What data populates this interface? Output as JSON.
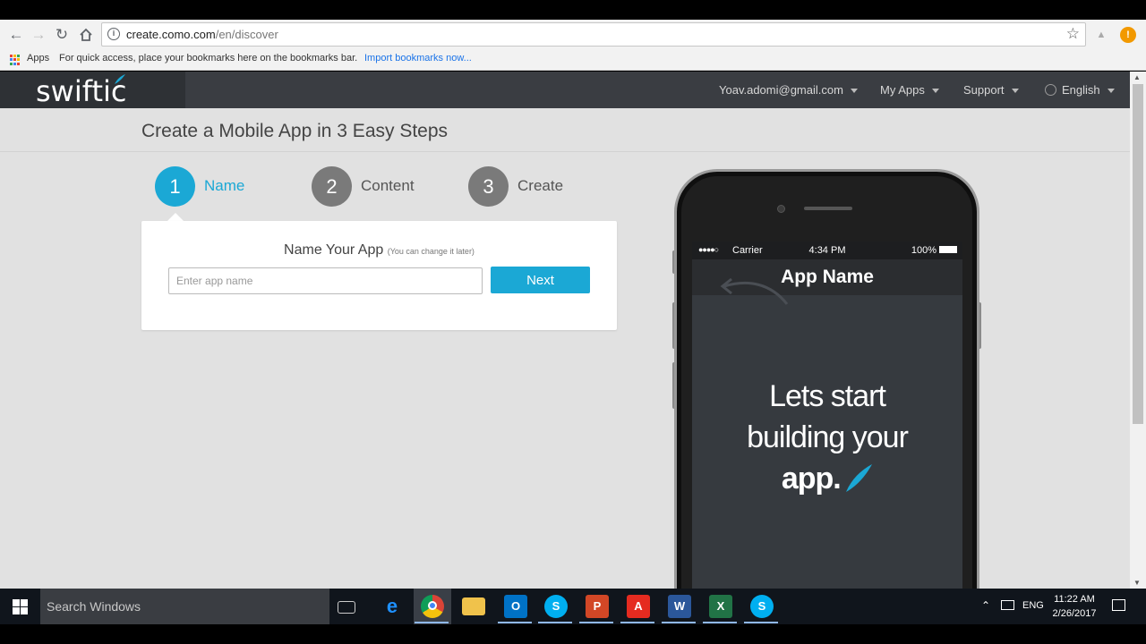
{
  "browser": {
    "url_host": "create.como.com",
    "url_path": "/en/discover",
    "bookmarks": {
      "apps_label": "Apps",
      "hint": "For quick access, place your bookmarks here on the bookmarks bar.",
      "import_link": "Import bookmarks now..."
    }
  },
  "header": {
    "logo": "swiftic",
    "menu": {
      "account": "Yoav.adomi@gmail.com",
      "my_apps": "My Apps",
      "support": "Support",
      "language": "English"
    }
  },
  "main": {
    "title": "Create a Mobile App in 3 Easy Steps",
    "steps": [
      {
        "number": "1",
        "label": "Name",
        "active": true
      },
      {
        "number": "2",
        "label": "Content",
        "active": false
      },
      {
        "number": "3",
        "label": "Create",
        "active": false
      }
    ],
    "card": {
      "title": "Name Your App",
      "subtitle": "(You can change it later)",
      "input_placeholder": "Enter app name",
      "next_label": "Next"
    }
  },
  "phone": {
    "status": {
      "carrier": "Carrier",
      "time": "4:34 PM",
      "battery": "100%"
    },
    "app_title": "App Name",
    "message_line1": "Lets start",
    "message_line2": "building your",
    "message_line3": "app."
  },
  "taskbar": {
    "search_placeholder": "Search Windows",
    "language": "ENG",
    "time": "11:22 AM",
    "date": "2/26/2017"
  },
  "colors": {
    "accent": "#1ba8d5",
    "step_inactive": "#7a7a7a",
    "topbar": "#3a3d42"
  }
}
